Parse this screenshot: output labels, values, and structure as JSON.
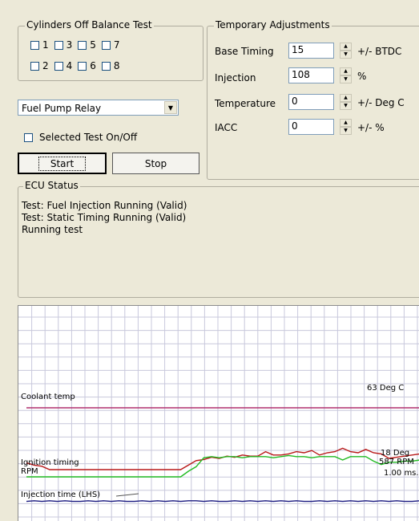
{
  "balance_test": {
    "title": "Cylinders Off Balance Test",
    "row1": [
      "1",
      "3",
      "5",
      "7"
    ],
    "row2": [
      "2",
      "4",
      "6",
      "8"
    ]
  },
  "temp_adjust": {
    "title": "Temporary Adjustments",
    "rows": [
      {
        "label": "Base Timing",
        "value": "15",
        "unit": "+/- BTDC"
      },
      {
        "label": "Injection",
        "value": "108",
        "unit": "%"
      },
      {
        "label": "Temperature",
        "value": "0",
        "unit": "+/- Deg C"
      },
      {
        "label": "IACC",
        "value": "0",
        "unit": "+/- %"
      }
    ]
  },
  "test_select": {
    "value": "Fuel Pump Relay"
  },
  "selected_test_label": "Selected Test On/Off",
  "buttons": {
    "start": "Start",
    "stop": "Stop"
  },
  "ecu_status": {
    "title": "ECU Status",
    "lines": [
      "Test: Fuel Injection Running (Valid)",
      "Test: Static Timing Running (Valid)",
      "Running test"
    ]
  },
  "chart_data": {
    "type": "line",
    "grid": true,
    "series": [
      {
        "name": "Coolant temp",
        "readout": "63 Deg C",
        "color": "#b0306f",
        "values": [
          63,
          63,
          63,
          63,
          63,
          63,
          63,
          63,
          63,
          63,
          63,
          63,
          63,
          63,
          63,
          63,
          63,
          63,
          63,
          63,
          63,
          63,
          63,
          63,
          63,
          63,
          63,
          63,
          63,
          63,
          63,
          63,
          63,
          63,
          63,
          63,
          63,
          63,
          63,
          63,
          63,
          63,
          63,
          63,
          63,
          63,
          63,
          63,
          63,
          63,
          63,
          63
        ]
      },
      {
        "name": "Ignition timing",
        "readout": "18 Deg",
        "color": "#b81818",
        "values": [
          0.6,
          0.4,
          0.3,
          0,
          0,
          0,
          0,
          0,
          0,
          0,
          0,
          0,
          0,
          0,
          0,
          0,
          0,
          0,
          0,
          0,
          0,
          0.4,
          0.8,
          0.9,
          1.1,
          1.0,
          1.2,
          1.1,
          1.3,
          1.2,
          1.2,
          1.6,
          1.3,
          1.3,
          1.4,
          1.6,
          1.5,
          1.7,
          1.3,
          1.5,
          1.6,
          1.9,
          1.6,
          1.5,
          1.8,
          1.5,
          1.4,
          1.0,
          1.1,
          1.2,
          1.3,
          1.4
        ]
      },
      {
        "name": "RPM",
        "readout": "587 RPM",
        "color": "#22bb22",
        "values": [
          0,
          0,
          0,
          0,
          0,
          0,
          0,
          0,
          0,
          0,
          0,
          0,
          0,
          0,
          0,
          0,
          0,
          0,
          0,
          0,
          0,
          0.5,
          0.9,
          1.7,
          1.8,
          1.7,
          1.8,
          1.8,
          1.7,
          1.8,
          1.8,
          1.8,
          1.7,
          1.8,
          1.9,
          1.8,
          1.8,
          1.7,
          1.8,
          1.8,
          1.8,
          1.5,
          1.8,
          1.8,
          1.8,
          1.4,
          1.1,
          1.3,
          1.3,
          1.4,
          1.4,
          1.5
        ]
      },
      {
        "name": "Injection time (LHS)",
        "readout": "1.00 ms.",
        "color": "#1a1a80",
        "values": [
          0.3,
          0.4,
          0.3,
          0.4,
          0.3,
          0.4,
          0.3,
          0.3,
          0.4,
          0.3,
          0.4,
          0.3,
          0.4,
          0.3,
          0.3,
          0.4,
          0.3,
          0.4,
          0.3,
          0.4,
          0.3,
          0.4,
          0.4,
          0.3,
          0.4,
          0.3,
          0.3,
          0.4,
          0.3,
          0.4,
          0.3,
          0.4,
          0.3,
          0.4,
          0.3,
          0.4,
          0.3,
          0.3,
          0.4,
          0.3,
          0.4,
          0.3,
          0.4,
          0.3,
          0.4,
          0.3,
          0.4,
          0.3,
          0.4,
          0.3,
          0.3,
          0.4
        ]
      }
    ]
  }
}
